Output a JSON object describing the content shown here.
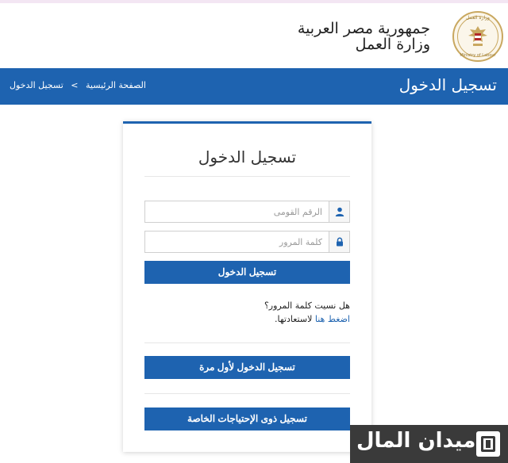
{
  "header": {
    "org_line1": "جمهورية مصر العربية",
    "org_line2": "وزارة العمل",
    "emblem_text_top": "وزارة العمل",
    "emblem_text_bottom": "Ministry of Labour"
  },
  "bar": {
    "title": "تسجيل الدخول",
    "breadcrumb": {
      "home": "الصفحة الرئيسية",
      "separator": ">",
      "current": "تسجيل الدخول"
    }
  },
  "login": {
    "title": "تسجيل الدخول",
    "national_id_placeholder": "الرقم القومى",
    "national_id_value": "",
    "password_placeholder": "كلمة المرور",
    "password_value": "",
    "submit_label": "تسجيل الدخول",
    "forgot_question": "هل نسيت كلمة المرور؟",
    "forgot_link": "اضغط هنا",
    "forgot_suffix": "لاستعادتها.",
    "first_time_label": "تسجيل الدخول لأول مرة",
    "special_needs_label": "تسجيل ذوى الإحتياجات الخاصة"
  },
  "icons": {
    "user": "user-icon",
    "lock": "lock-icon",
    "emblem": "eagle-emblem-icon"
  },
  "colors": {
    "primary": "#1e63b0",
    "emblem_gold": "#c9a860",
    "watermark_bg": "#3a3a3a"
  },
  "watermark": {
    "text": "ميدان المال"
  }
}
